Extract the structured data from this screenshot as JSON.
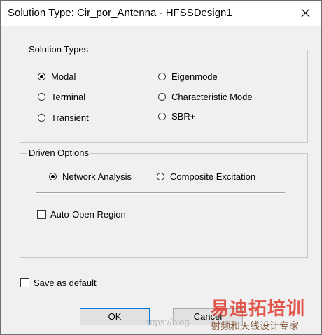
{
  "window": {
    "title": "Solution Type: Cir_por_Antenna - HFSSDesign1"
  },
  "solution_types": {
    "legend": "Solution Types",
    "options": [
      {
        "label": "Modal",
        "selected": true
      },
      {
        "label": "Terminal",
        "selected": false
      },
      {
        "label": "Transient",
        "selected": false
      },
      {
        "label": "Eigenmode",
        "selected": false
      },
      {
        "label": "Characteristic Mode",
        "selected": false
      },
      {
        "label": "SBR+",
        "selected": false
      }
    ]
  },
  "driven_options": {
    "legend": "Driven Options",
    "options": [
      {
        "label": "Network Analysis",
        "selected": true
      },
      {
        "label": "Composite Excitation",
        "selected": false
      }
    ],
    "auto_open_region": {
      "label": "Auto-Open Region",
      "checked": false
    }
  },
  "save_as_default": {
    "label": "Save as default",
    "checked": false
  },
  "buttons": {
    "ok": "OK",
    "cancel": "Cancel"
  },
  "watermark": {
    "url": "https://blog",
    "title": "易迪拓培训",
    "subtitle": "射频和天线设计专家"
  }
}
